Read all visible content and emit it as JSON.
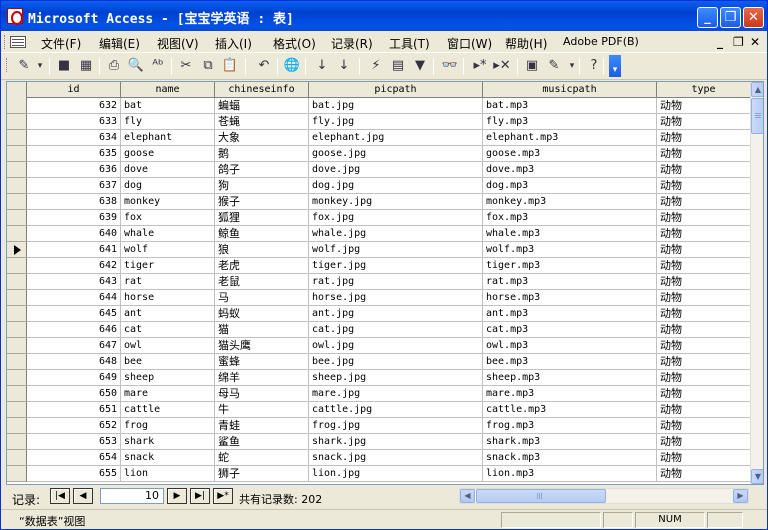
{
  "window": {
    "title": "Microsoft Access - [宝宝学英语 : 表]",
    "minimize_glyph": "_",
    "restore_glyph": "❐",
    "close_glyph": "✕"
  },
  "menu": {
    "items": [
      "文件(F)",
      "编辑(E)",
      "视图(V)",
      "插入(I)",
      "格式(O)",
      "记录(R)",
      "工具(T)",
      "窗口(W)",
      "帮助(H)",
      "Adobe PDF(B)"
    ],
    "mdi_min": "_",
    "mdi_restore": "❐",
    "mdi_close": "✕"
  },
  "toolbar": {
    "icons": [
      "design-view-icon",
      "dropdown-arrow-icon",
      "save-icon",
      "file-search-icon",
      "print-icon",
      "print-preview-icon",
      "spelling-icon",
      "cut-icon",
      "copy-icon",
      "paste-icon",
      "undo-icon",
      "hyperlink-icon",
      "sort-ascending-icon",
      "sort-descending-icon",
      "filter-by-selection-icon",
      "filter-by-form-icon",
      "apply-filter-icon",
      "find-icon",
      "new-record-icon",
      "delete-record-icon",
      "properties-icon",
      "new-object-icon",
      "dropdown-arrow-icon",
      "help-icon",
      "toolbar-options-icon"
    ],
    "glyphs": [
      "✎",
      "▾",
      "■",
      "▦",
      "⎙",
      "🔍",
      "ᴬᵇ",
      "✂",
      "⧉",
      "📋",
      "↶",
      "🌐",
      "↓",
      "↓",
      "⚡",
      "▤",
      "▼",
      "👓",
      "▸*",
      "▸✕",
      "▣",
      "✎",
      "▾",
      "?",
      "▾"
    ]
  },
  "columns": [
    "id",
    "name",
    "chineseinfo",
    "picpath",
    "musicpath",
    "type"
  ],
  "rows": [
    [
      "632",
      "bat",
      "蝙蝠",
      "bat.jpg",
      "bat.mp3",
      "动物"
    ],
    [
      "633",
      "fly",
      "苍蝇",
      "fly.jpg",
      "fly.mp3",
      "动物"
    ],
    [
      "634",
      "elephant",
      "大象",
      "elephant.jpg",
      "elephant.mp3",
      "动物"
    ],
    [
      "635",
      "goose",
      "鹅",
      "goose.jpg",
      "goose.mp3",
      "动物"
    ],
    [
      "636",
      "dove",
      "鸽子",
      "dove.jpg",
      "dove.mp3",
      "动物"
    ],
    [
      "637",
      "dog",
      "狗",
      "dog.jpg",
      "dog.mp3",
      "动物"
    ],
    [
      "638",
      "monkey",
      "猴子",
      "monkey.jpg",
      "monkey.mp3",
      "动物"
    ],
    [
      "639",
      "fox",
      "狐狸",
      "fox.jpg",
      "fox.mp3",
      "动物"
    ],
    [
      "640",
      "whale",
      "鲸鱼",
      "whale.jpg",
      "whale.mp3",
      "动物"
    ],
    [
      "641",
      "wolf",
      "狼",
      "wolf.jpg",
      "wolf.mp3",
      "动物"
    ],
    [
      "642",
      "tiger",
      "老虎",
      "tiger.jpg",
      "tiger.mp3",
      "动物"
    ],
    [
      "643",
      "rat",
      "老鼠",
      "rat.jpg",
      "rat.mp3",
      "动物"
    ],
    [
      "644",
      "horse",
      "马",
      "horse.jpg",
      "horse.mp3",
      "动物"
    ],
    [
      "645",
      "ant",
      "蚂蚁",
      "ant.jpg",
      "ant.mp3",
      "动物"
    ],
    [
      "646",
      "cat",
      "猫",
      "cat.jpg",
      "cat.mp3",
      "动物"
    ],
    [
      "647",
      "owl",
      "猫头鹰",
      "owl.jpg",
      "owl.mp3",
      "动物"
    ],
    [
      "648",
      "bee",
      "蜜蜂",
      "bee.jpg",
      "bee.mp3",
      "动物"
    ],
    [
      "649",
      "sheep",
      "绵羊",
      "sheep.jpg",
      "sheep.mp3",
      "动物"
    ],
    [
      "650",
      "mare",
      "母马",
      "mare.jpg",
      "mare.mp3",
      "动物"
    ],
    [
      "651",
      "cattle",
      "牛",
      "cattle.jpg",
      "cattle.mp3",
      "动物"
    ],
    [
      "652",
      "frog",
      "青蛙",
      "frog.jpg",
      "frog.mp3",
      "动物"
    ],
    [
      "653",
      "shark",
      "鲨鱼",
      "shark.jpg",
      "shark.mp3",
      "动物"
    ],
    [
      "654",
      "snack",
      "蛇",
      "snack.jpg",
      "snack.mp3",
      "动物"
    ],
    [
      "655",
      "lion",
      "狮子",
      "lion.jpg",
      "lion.mp3",
      "动物"
    ]
  ],
  "current_row_index": 9,
  "nav": {
    "label": "记录:",
    "first": "|◀",
    "prev": "◀",
    "current": "10",
    "next": "▶",
    "last": "▶|",
    "new": "▶*",
    "count": "共有记录数: 202"
  },
  "scroll": {
    "up": "▲",
    "down": "▼",
    "left": "◀",
    "right": "▶"
  },
  "status": {
    "text": "“数据表”视图",
    "num": "NUM"
  }
}
